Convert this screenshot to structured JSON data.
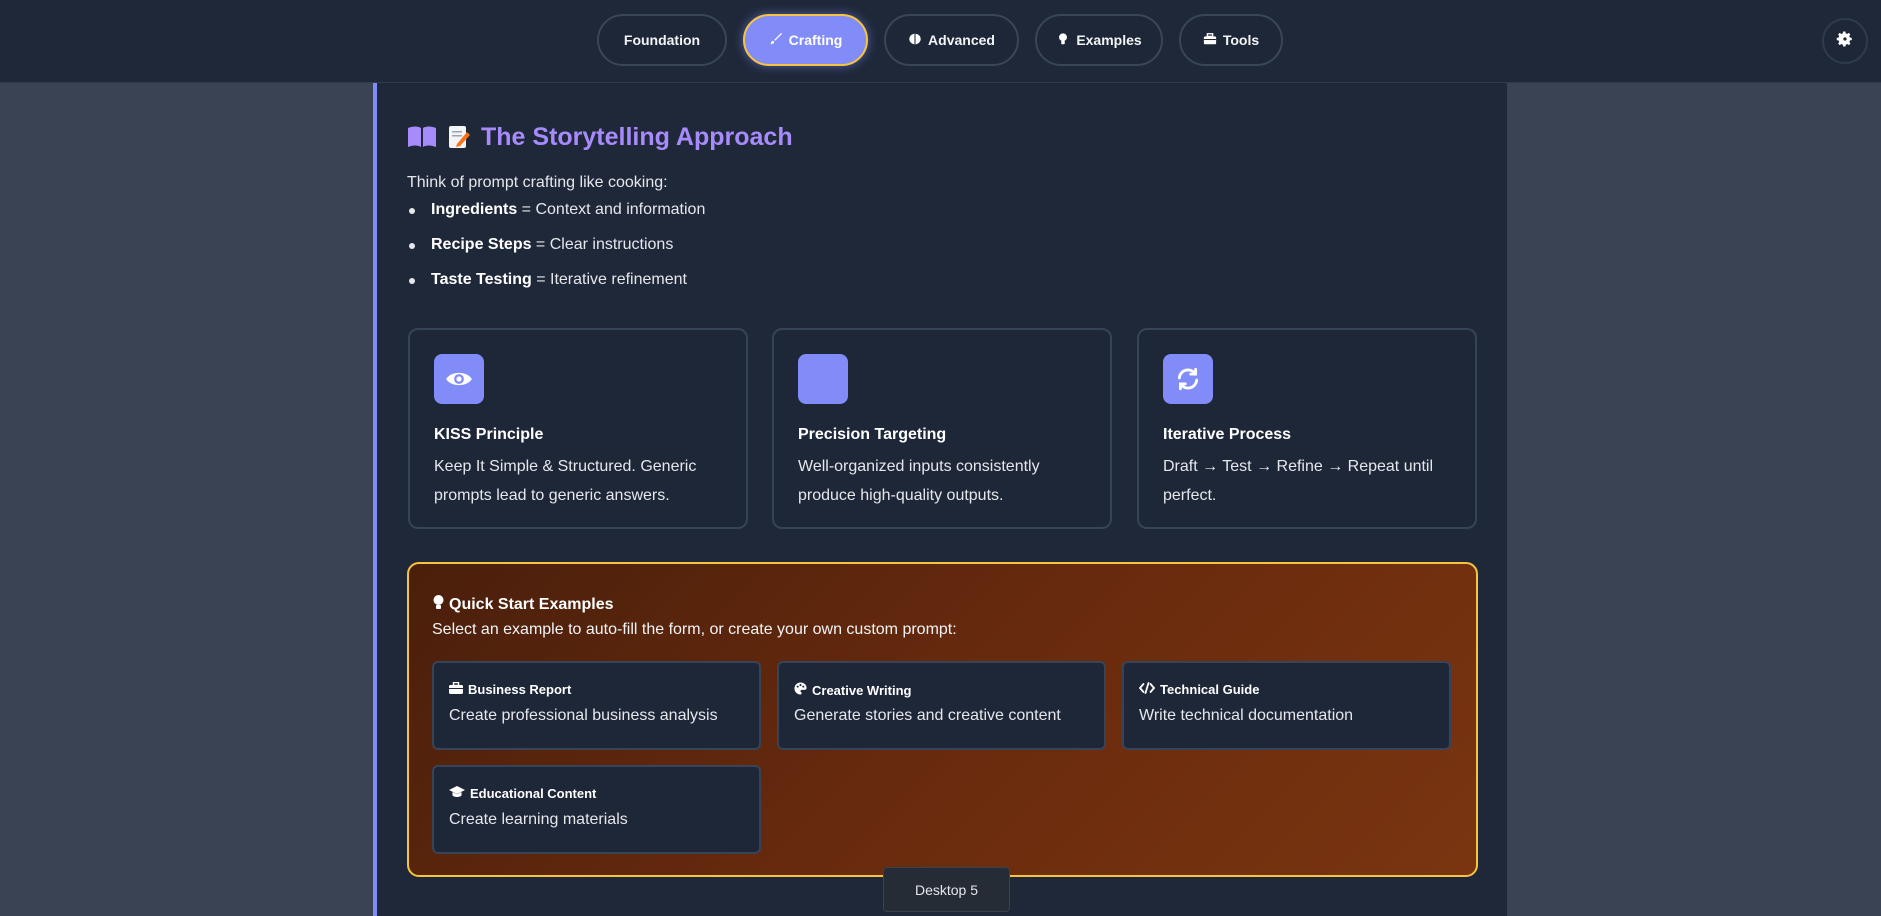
{
  "nav": {
    "tabs": [
      {
        "label": "Foundation",
        "icon": "none"
      },
      {
        "label": "Crafting",
        "icon": "brush-icon",
        "active": true
      },
      {
        "label": "Advanced",
        "icon": "brain-icon"
      },
      {
        "label": "Examples",
        "icon": "lightbulb-icon"
      },
      {
        "label": "Tools",
        "icon": "toolbox-icon"
      }
    ],
    "settings_icon": "gear-icon"
  },
  "section": {
    "title": "The Storytelling Approach",
    "title_icons": [
      "book-icon",
      "memo-icon"
    ],
    "intro": "Think of prompt crafting like cooking:",
    "bullets": [
      {
        "term": "Ingredients",
        "rest": " = Context and information"
      },
      {
        "term": "Recipe Steps",
        "rest": " = Clear instructions"
      },
      {
        "term": "Taste Testing",
        "rest": " = Iterative refinement"
      }
    ]
  },
  "cards": [
    {
      "title": "KISS Principle",
      "text": "Keep It Simple & Structured. Generic prompts lead to generic answers.",
      "icon": "eye-icon"
    },
    {
      "title": "Precision Targeting",
      "text": "Well-organized inputs consistently produce high-quality outputs.",
      "icon": "blank-icon"
    },
    {
      "title": "Iterative Process",
      "text": "Draft → Test → Refine → Repeat until perfect.",
      "icon": "refresh-icon"
    }
  ],
  "quick_start": {
    "title": "Quick Start Examples",
    "subtitle": "Select an example to auto-fill the form, or create your own custom prompt:",
    "examples": [
      {
        "title": "Business Report",
        "desc": "Create professional business analysis",
        "icon": "briefcase-icon"
      },
      {
        "title": "Creative Writing",
        "desc": "Generate stories and creative content",
        "icon": "palette-icon"
      },
      {
        "title": "Technical Guide",
        "desc": "Write technical documentation",
        "icon": "code-icon"
      },
      {
        "title": "Educational Content",
        "desc": "Create learning materials",
        "icon": "graduation-cap-icon"
      }
    ]
  },
  "tooltip": "Desktop 5",
  "colors": {
    "accent": "#818cf8",
    "title": "#a78bfa",
    "highlight_border": "#f5c542",
    "panel": "#1f2839",
    "page": "#3a4353"
  }
}
